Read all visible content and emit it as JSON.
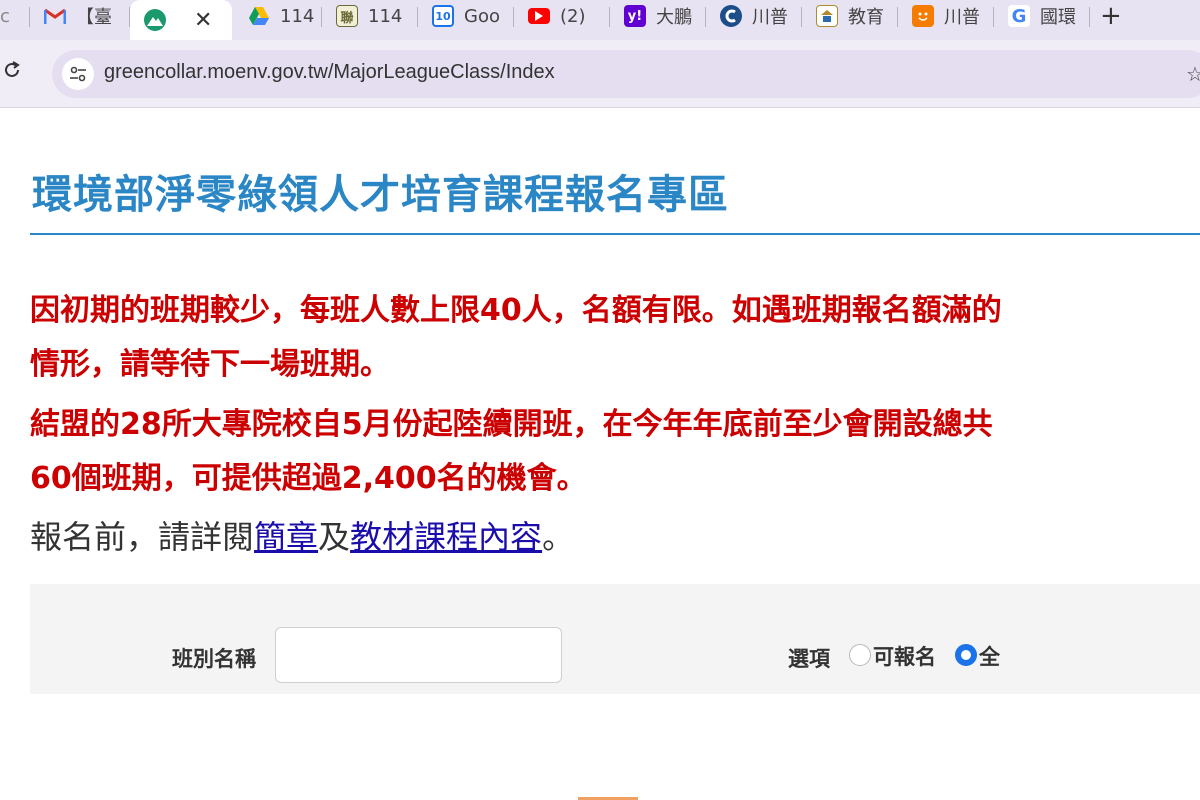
{
  "browser": {
    "tabs": [
      {
        "favicon": "partial-icon",
        "label": "c",
        "color": "#888888"
      },
      {
        "favicon": "gmail-icon",
        "label": "【臺",
        "color": "#d93025"
      },
      {
        "favicon": "moenv-mountain-icon",
        "label": "",
        "color": "#1a9a6c",
        "active": true
      },
      {
        "favicon": "google-drive-icon",
        "label": "114",
        "color": "#fbbc04"
      },
      {
        "favicon": "document-icon",
        "label": "114",
        "color": "#6b6b3a",
        "glyph": "聯"
      },
      {
        "favicon": "google-calendar-icon",
        "label": "Goo",
        "color": "#1a73e8",
        "glyph": "10"
      },
      {
        "favicon": "youtube-icon",
        "label": "(2)",
        "color": "#ff0000"
      },
      {
        "favicon": "yahoo-icon",
        "label": "大鵬",
        "color": "#6001d2",
        "glyph": "y!"
      },
      {
        "favicon": "site-c-icon",
        "label": "川普",
        "color": "#1d4e89"
      },
      {
        "favicon": "school-icon",
        "label": "教育",
        "color": "#b08b2a"
      },
      {
        "favicon": "orange-face-icon",
        "label": "川普",
        "color": "#f57c00"
      },
      {
        "favicon": "google-icon",
        "label": "國環",
        "color": "#4285f4",
        "glyph": "G"
      }
    ],
    "url": "greencollar.moenv.gov.tw/MajorLeagueClass/Index"
  },
  "page": {
    "title": "環境部淨零綠領人才培育課程報名專區",
    "notice_1": [
      "因初期的班期較少，每班人數上限40人，名額有限。如遇班期報名額滿的",
      "情形，請等待下一場班期。"
    ],
    "notice_2": [
      "結盟的28所大專院校自5月份起陸續開班，在今年年底前至少會開設總共",
      "60個班期，可提供超過2,400名的機會。"
    ],
    "info_prefix": "報名前，請詳閱",
    "link_brochure": "簡章",
    "info_mid": "及",
    "link_materials": "教材課程內容",
    "info_suffix": "。"
  },
  "filter": {
    "class_name_label": "班別名稱",
    "class_name_value": "",
    "options_label": "選項",
    "option_available": "可報名",
    "option_all": "全",
    "selected": "全"
  },
  "colors": {
    "title": "#2b86c5",
    "notice": "#cc0000",
    "link": "#1a0dab",
    "radio_selected": "#1a73e8"
  }
}
